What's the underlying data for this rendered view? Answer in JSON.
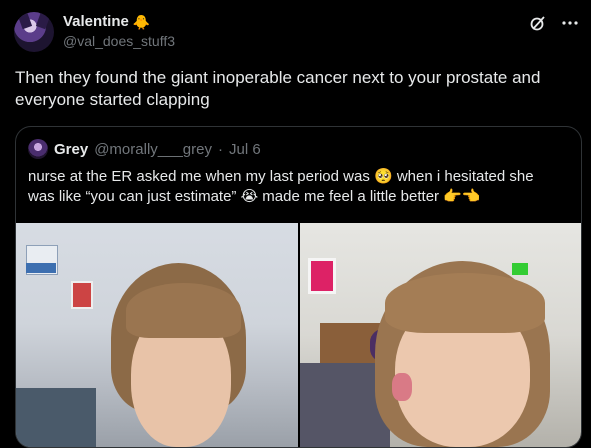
{
  "tweet": {
    "display_name": "Valentine",
    "name_emoji": "🐥",
    "handle": "@val_does_stuff3",
    "text": "Then they found the giant inoperable cancer next to your prostate and everyone started clapping"
  },
  "icons": {
    "grok": "grok-icon",
    "more": "more-icon"
  },
  "quote": {
    "display_name": "Grey",
    "handle": "@morally___grey",
    "separator": "·",
    "date": "Jul 6",
    "text": "nurse at the ER asked me when my last period was 🥺 when i hesitated she was like “you can just estimate” 😭 made me feel a little better 👉👈",
    "photos": [
      "selfie-left",
      "selfie-right"
    ]
  },
  "colors": {
    "background": "#000000",
    "text": "#e7e9ea",
    "muted": "#71767b",
    "border": "#2f3336"
  }
}
